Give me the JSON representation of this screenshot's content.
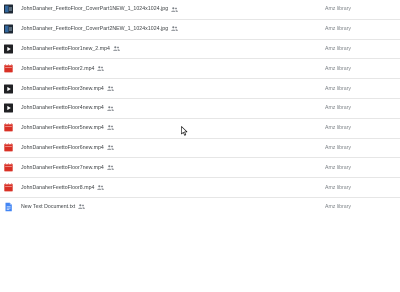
{
  "files": [
    {
      "name": "JohnDanaher_FeettoFloor_CoverPart1NEW_1_1024x1024.jpg",
      "owner": "Amz library",
      "icon": "image-thumbnail-icon",
      "type": "image"
    },
    {
      "name": "JohnDanaher_FeettoFloor_CoverPart2NEW_1_1024x1024.jpg",
      "owner": "Amz library",
      "icon": "image-thumbnail-icon",
      "type": "image"
    },
    {
      "name": "JohnDanaherFeettoFloor1new_2.mp4",
      "owner": "Amz library",
      "icon": "video-thumbnail-icon",
      "type": "video-thumb"
    },
    {
      "name": "JohnDanaherFeettoFloor2.mp4",
      "owner": "Amz library",
      "icon": "video-file-icon",
      "type": "video"
    },
    {
      "name": "JohnDanaherFeettoFloor3new.mp4",
      "owner": "Amz library",
      "icon": "video-thumbnail-icon",
      "type": "video-thumb"
    },
    {
      "name": "JohnDanaherFeettoFloor4new.mp4",
      "owner": "Amz library",
      "icon": "video-thumbnail-icon",
      "type": "video-thumb"
    },
    {
      "name": "JohnDanaherFeettoFloor5new.mp4",
      "owner": "Amz library",
      "icon": "video-file-icon",
      "type": "video"
    },
    {
      "name": "JohnDanaherFeettoFloor6new.mp4",
      "owner": "Amz library",
      "icon": "video-file-icon",
      "type": "video"
    },
    {
      "name": "JohnDanaherFeettoFloor7new.mp4",
      "owner": "Amz library",
      "icon": "video-file-icon",
      "type": "video"
    },
    {
      "name": "JohnDanaherFeettoFloor8.mp4",
      "owner": "Amz library",
      "icon": "video-file-icon",
      "type": "video"
    },
    {
      "name": "New Text Document.txt",
      "owner": "Amz library",
      "icon": "document-icon",
      "type": "doc"
    }
  ],
  "shared_icon": "shared-people-icon",
  "colors": {
    "video": "#d93025",
    "doc": "#4285f4",
    "thumb_dark": "#1f2a36",
    "thumb_accent": "#3a7bbf",
    "text": "#3c4043",
    "owner_text": "#80868b",
    "divider": "#e6e6e6"
  }
}
